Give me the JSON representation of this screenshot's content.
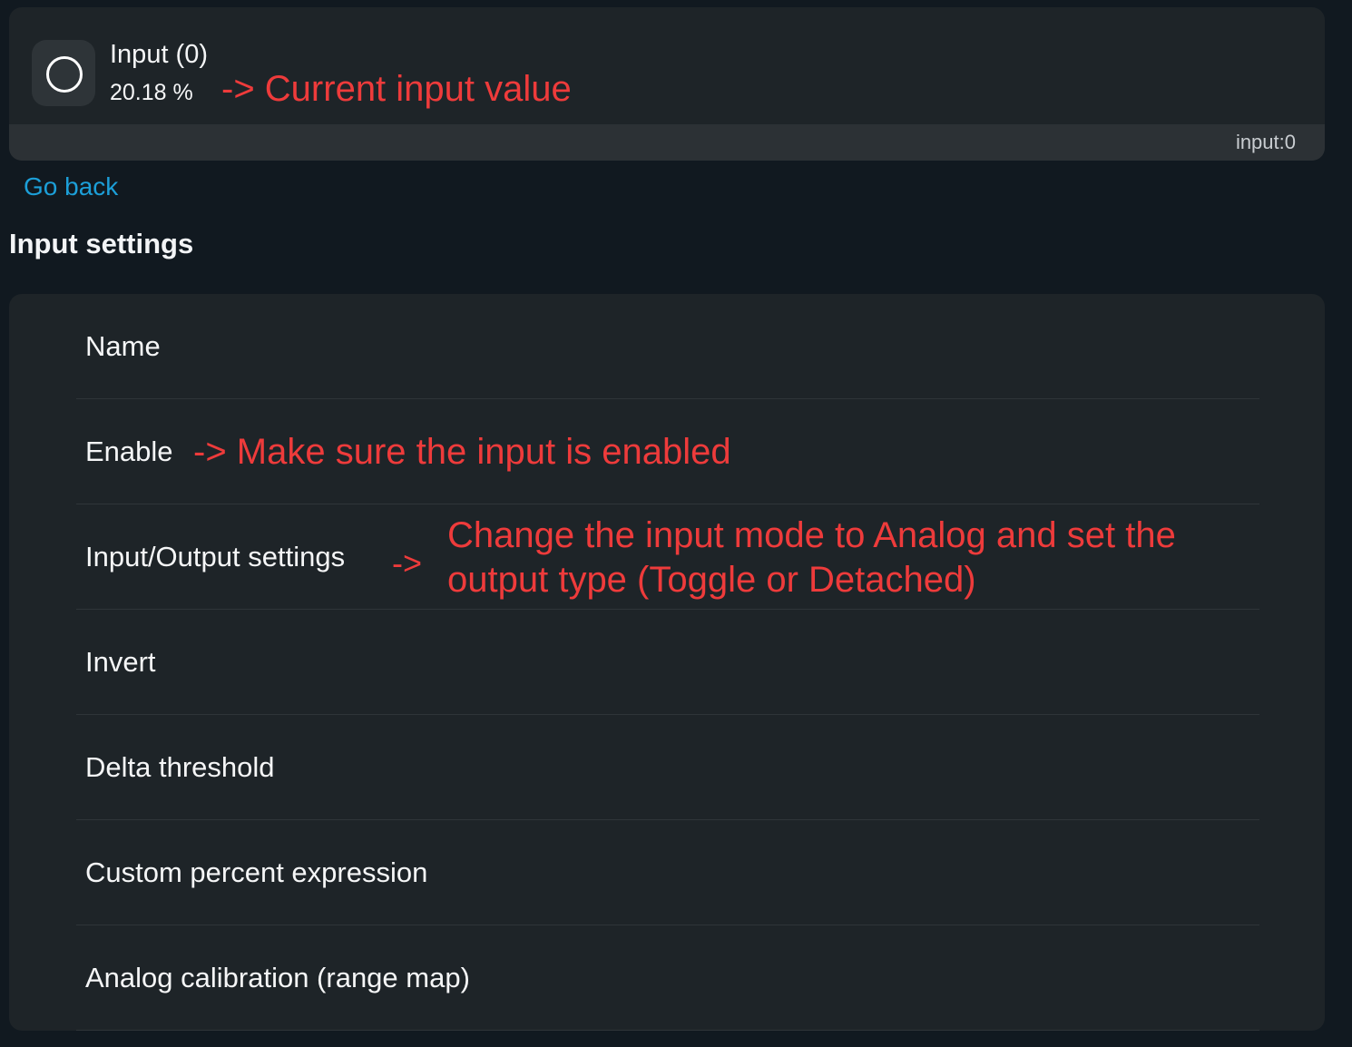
{
  "entity": {
    "icon": "circle-outline-icon",
    "name": "Input (0)",
    "value": "20.18 %",
    "id": "input:0",
    "annotation": "-> Current input value"
  },
  "nav": {
    "go_back": "Go back"
  },
  "section": {
    "title": "Input settings"
  },
  "settings": {
    "rows": [
      {
        "label": "Name"
      },
      {
        "label": "Enable",
        "annotation": "-> Make sure the input is enabled"
      },
      {
        "label": "Input/Output settings",
        "annotation_arrow": "->",
        "annotation_line1": "Change the input mode to Analog and set the",
        "annotation_line2": "output type (Toggle or Detached)"
      },
      {
        "label": "Invert"
      },
      {
        "label": "Delta threshold"
      },
      {
        "label": "Custom percent expression"
      },
      {
        "label": "Analog calibration (range map)"
      }
    ]
  },
  "colors": {
    "background": "#111920",
    "card": "#1e2428",
    "link": "#1c9fd8",
    "annotation": "#ee3b3b"
  }
}
